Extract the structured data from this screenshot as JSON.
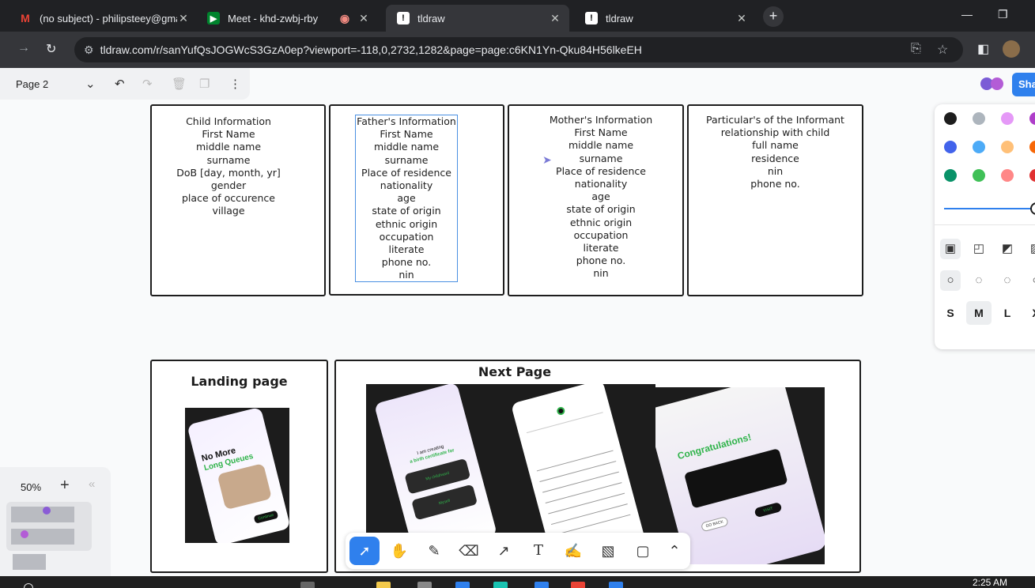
{
  "browser": {
    "tabs": [
      {
        "title": "(no subject) - philipsteey@gmail",
        "favicon": "gmail-icon",
        "active": false
      },
      {
        "title": "Meet - khd-zwbj-rby",
        "favicon": "meet-icon",
        "active": false
      },
      {
        "title": "tldraw",
        "favicon": "tldraw-icon",
        "active": true
      },
      {
        "title": "tldraw",
        "favicon": "tldraw-icon",
        "active": false
      }
    ],
    "url": "tldraw.com/r/sanYufQsJOGWcS3GzA0ep?viewport=-118,0,2732,1282&page=page:c6KN1Yn-Qku84H56lkeEH"
  },
  "app": {
    "page_name": "Page 2",
    "share_label": "Sha",
    "zoom": "50%",
    "style_panel": {
      "colors": [
        "#1d1d1d",
        "#adb5bd",
        "#e599f7",
        "#ae3ec9",
        "#4263eb",
        "#4dabf7",
        "#ffc078",
        "#f76707",
        "#099268",
        "#40c057",
        "#ff8787",
        "#e03131"
      ],
      "sizes": [
        "S",
        "M",
        "L",
        "X"
      ],
      "selected_size": "M"
    },
    "tools": [
      "select-tool",
      "hand-tool",
      "draw-tool",
      "eraser-tool",
      "arrow-tool",
      "text-tool",
      "note-tool",
      "media-tool",
      "rectangle-tool",
      "more-tools"
    ]
  },
  "canvas": {
    "child_info": [
      "Child Information",
      "First Name",
      "middle name",
      "surname",
      "DoB [day,  month, yr]",
      "gender",
      "place of occurence",
      "village"
    ],
    "father_info": [
      "Father's Information",
      "First Name",
      "middle name",
      "surname",
      "Place of residence",
      "nationality",
      "age",
      "state of origin",
      "ethnic origin",
      "occupation",
      "literate",
      "phone no.",
      "nin"
    ],
    "mother_info": [
      "Mother's Information",
      "First Name",
      "middle name",
      "surname",
      "Place of residence",
      "nationality",
      "age",
      "state of origin",
      "ethnic origin",
      "occupation",
      "literate",
      "phone no.",
      "nin"
    ],
    "informant_info": [
      "Particular's of the Informant",
      "relationship with child",
      "full name",
      "residence",
      "nin",
      "phone no."
    ],
    "landing_title": "Landing page",
    "next_title": "Next Page",
    "phone_landing": {
      "headline1": "No More",
      "headline2": "Long Queues",
      "btn": "Continue"
    },
    "phone_next1": {
      "text1": "I am creating",
      "text2": "a birth certificate for",
      "opt1": "My child/ward",
      "opt2": "Myself"
    },
    "phone_next3": {
      "headline": "Congratulations!",
      "btn1": "GO BACK",
      "btn2": "VISIT"
    }
  },
  "taskbar": {
    "time": "2:25 AM"
  }
}
